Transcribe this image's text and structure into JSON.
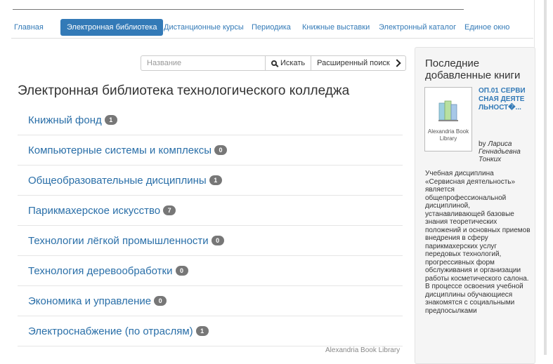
{
  "nav": {
    "tabs": [
      {
        "label": "Главная"
      },
      {
        "label": "Электронная библиотека"
      },
      {
        "label": "Дистанционные курсы"
      },
      {
        "label": "Периодика"
      },
      {
        "label": "Книжные выставки"
      },
      {
        "label": "Электронный каталог"
      },
      {
        "label": "Единое окно"
      }
    ],
    "active_index": 1
  },
  "search": {
    "placeholder": "Название",
    "search_label": "Искать",
    "advanced_label": "Расширенный поиск"
  },
  "page_title": "Электронная библиотека технологического колледжа",
  "categories": [
    {
      "name": "Книжный фонд",
      "count": "1"
    },
    {
      "name": "Компьютерные системы и комплексы",
      "count": "0"
    },
    {
      "name": "Общеобразовательные дисциплины",
      "count": "1"
    },
    {
      "name": "Парикмахерское искусство",
      "count": "7"
    },
    {
      "name": "Технологии лёгкой промышленности",
      "count": "0"
    },
    {
      "name": "Технология деревообработки",
      "count": "0"
    },
    {
      "name": "Экономика и управление",
      "count": "0"
    },
    {
      "name": "Электроснабжение (по отраслям)",
      "count": "1"
    }
  ],
  "footer": "Alexandria Book Library",
  "sidebar": {
    "title": "Последние добавленные книги",
    "book": {
      "thumb_caption": "Alexandria Book Library",
      "title": "ОП.01 СЕРВИСНАЯ ДЕЯТЕЛЬНОСТ�...",
      "by": "by",
      "author": "Лариса Геннадьевна Тонких",
      "description": "Учебная дисциплина «Сервисная деятельность» является общепрофессиональной дисциплиной, устанавливающей базовые знания теоретических положений и основных приемов внедрения в сферу парикмахерских услуг передовых технологий, прогрессивных форм обслуживания и организации работы косметического салона. В процессе освоения учебной дисциплины обучающиеся знакомятся с социальными предпосылками"
    }
  },
  "colors": {
    "accent": "#337ab7",
    "badge": "#777777",
    "link": "#2a6fa8"
  }
}
